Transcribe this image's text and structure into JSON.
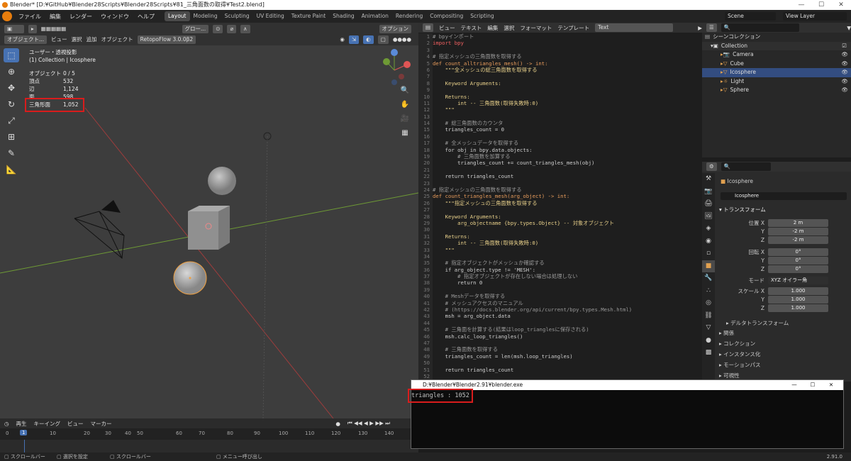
{
  "window": {
    "title": "Blender* [D:¥GitHub¥Blender28Scripts¥Blender28Scripts¥81_三角面数の取得¥Test2.blend]",
    "controls": [
      "—",
      "☐",
      "✕"
    ]
  },
  "menus": [
    "ファイル",
    "編集",
    "レンダー",
    "ウィンドウ",
    "ヘルプ"
  ],
  "workspaces": [
    "Layout",
    "Modeling",
    "Sculpting",
    "UV Editing",
    "Texture Paint",
    "Shading",
    "Animation",
    "Rendering",
    "Compositing",
    "Scripting"
  ],
  "scene": {
    "label": "Scene",
    "view_layer": "View Layer"
  },
  "viewport": {
    "mode": "オブジェクト...",
    "menu": [
      "ビュー",
      "選択",
      "追加",
      "オブジェクト"
    ],
    "addon": "RetopoFlow 3.0.0β2",
    "transform": "グロー...",
    "options": "オプション",
    "view_title": "ユーザー・透視投影",
    "collection_line": "(1) Collection | Icosphere",
    "stats": [
      {
        "k": "オブジェクト",
        "v": "0 / 5"
      },
      {
        "k": "頂点",
        "v": "532"
      },
      {
        "k": "辺",
        "v": "1,124"
      },
      {
        "k": "面",
        "v": "598"
      },
      {
        "k": "三角形面",
        "v": "1,052"
      }
    ]
  },
  "timeline": {
    "menu": [
      "再生",
      "キーイング",
      "ビュー",
      "マーカー"
    ],
    "frames": [
      "0",
      "10",
      "20",
      "30",
      "40",
      "50",
      "60",
      "70",
      "80",
      "90",
      "100",
      "110",
      "120",
      "130",
      "140"
    ],
    "current": "1"
  },
  "status": {
    "items": [
      "スクロールバー",
      "選択を設定",
      "スクロールバー",
      "メニュー呼び出し"
    ],
    "version": "2.91.0"
  },
  "text_editor": {
    "menu": [
      "ビュー",
      "テキスト",
      "編集",
      "選択",
      "フォーマット",
      "テンプレート"
    ],
    "name": "Text"
  },
  "code": [
    {
      "n": "1",
      "t": "# bpyインポート",
      "c": "com"
    },
    {
      "n": "2",
      "t": "import bpy",
      "c": "kw"
    },
    {
      "n": "3",
      "t": "",
      "c": ""
    },
    {
      "n": "4",
      "t": "# 指定メッシュの三角面数を取得する",
      "c": "com"
    },
    {
      "n": "5",
      "t": "def count_alltriangles_mesh() -> int:",
      "c": "def"
    },
    {
      "n": "6",
      "t": "    \"\"\"全メッシュの総三角面数を取得する",
      "c": "str"
    },
    {
      "n": "7",
      "t": "",
      "c": ""
    },
    {
      "n": "8",
      "t": "    Keyword Arguments:",
      "c": "str"
    },
    {
      "n": "9",
      "t": "",
      "c": ""
    },
    {
      "n": "10",
      "t": "    Returns:",
      "c": "str"
    },
    {
      "n": "11",
      "t": "        int -- 三角面数(取得失敗時:0)",
      "c": "str"
    },
    {
      "n": "12",
      "t": "    \"\"\"",
      "c": "str"
    },
    {
      "n": "13",
      "t": "",
      "c": ""
    },
    {
      "n": "14",
      "t": "    # 総三角面数のカウンタ",
      "c": "com"
    },
    {
      "n": "15",
      "t": "    triangles_count = 0",
      "c": ""
    },
    {
      "n": "16",
      "t": "",
      "c": ""
    },
    {
      "n": "17",
      "t": "    # 全メッシュデータを取得する",
      "c": "com"
    },
    {
      "n": "18",
      "t": "    for obj in bpy.data.objects:",
      "c": ""
    },
    {
      "n": "19",
      "t": "        # 三角面数を加算する",
      "c": "com"
    },
    {
      "n": "20",
      "t": "        triangles_count += count_triangles_mesh(obj)",
      "c": ""
    },
    {
      "n": "21",
      "t": "",
      "c": ""
    },
    {
      "n": "22",
      "t": "    return triangles_count",
      "c": ""
    },
    {
      "n": "23",
      "t": "",
      "c": ""
    },
    {
      "n": "24",
      "t": "# 指定メッシュの三角面数を取得する",
      "c": "com"
    },
    {
      "n": "25",
      "t": "def count_triangles_mesh(arg_object) -> int:",
      "c": "def"
    },
    {
      "n": "26",
      "t": "    \"\"\"指定メッシュの三角面数を取得する",
      "c": "str"
    },
    {
      "n": "27",
      "t": "",
      "c": ""
    },
    {
      "n": "28",
      "t": "    Keyword Arguments:",
      "c": "str"
    },
    {
      "n": "29",
      "t": "        arg_objectname {bpy.types.Object} -- 対象オブジェクト",
      "c": "str"
    },
    {
      "n": "30",
      "t": "",
      "c": ""
    },
    {
      "n": "31",
      "t": "    Returns:",
      "c": "str"
    },
    {
      "n": "32",
      "t": "        int -- 三角面数(取得失敗時:0)",
      "c": "str"
    },
    {
      "n": "33",
      "t": "    \"\"\"",
      "c": "str"
    },
    {
      "n": "34",
      "t": "",
      "c": ""
    },
    {
      "n": "35",
      "t": "    # 指定オブジェクトがメッシュか確認する",
      "c": "com"
    },
    {
      "n": "36",
      "t": "    if arg_object.type != 'MESH':",
      "c": ""
    },
    {
      "n": "37",
      "t": "        # 指定オブジェクトが存在しない場合は処理しない",
      "c": "com"
    },
    {
      "n": "38",
      "t": "        return 0",
      "c": ""
    },
    {
      "n": "39",
      "t": "",
      "c": ""
    },
    {
      "n": "40",
      "t": "    # Meshデータを取得する",
      "c": "com"
    },
    {
      "n": "41",
      "t": "    # メッシュアクセスのマニュアル",
      "c": "com"
    },
    {
      "n": "42",
      "t": "    # (https://docs.blender.org/api/current/bpy.types.Mesh.html)",
      "c": "com"
    },
    {
      "n": "43",
      "t": "    msh = arg_object.data",
      "c": ""
    },
    {
      "n": "44",
      "t": "",
      "c": ""
    },
    {
      "n": "45",
      "t": "    # 三角面を計算する(結果はloop_trianglesに保存される)",
      "c": "com"
    },
    {
      "n": "46",
      "t": "    msh.calc_loop_triangles()",
      "c": ""
    },
    {
      "n": "47",
      "t": "",
      "c": ""
    },
    {
      "n": "48",
      "t": "    # 三角面数を取得する",
      "c": "com"
    },
    {
      "n": "49",
      "t": "    triangles_count = len(msh.loop_triangles)",
      "c": ""
    },
    {
      "n": "50",
      "t": "",
      "c": ""
    },
    {
      "n": "51",
      "t": "    return triangles_count",
      "c": ""
    },
    {
      "n": "52",
      "t": "",
      "c": ""
    }
  ],
  "outliner": {
    "title": "シーンコレクション",
    "collection": "Collection",
    "objects": [
      "Camera",
      "Cube",
      "Icosphere",
      "Light",
      "Sphere"
    ]
  },
  "properties": {
    "object_name": "Icosphere",
    "data_name": "Icosphere",
    "transform_label": "トランスフォーム",
    "location_label": "位置 X",
    "rotation_label": "回転 X",
    "mode_label": "モード",
    "mode_value": "XYZ オイラー角",
    "scale_label": "スケール X",
    "axis_y": "Y",
    "axis_z": "Z",
    "location": [
      "2 m",
      "-2 m",
      "-2 m"
    ],
    "rotation": [
      "0°",
      "0°",
      "0°"
    ],
    "scale": [
      "1.000",
      "1.000",
      "1.000"
    ],
    "sections": [
      "デルタトランスフォーム",
      "関係",
      "コレクション",
      "インスタンス化",
      "モーションパス",
      "可視性"
    ]
  },
  "console": {
    "title": "D:¥Blender¥Blender2.91¥blender.exe",
    "output": "triangles : 1052"
  }
}
